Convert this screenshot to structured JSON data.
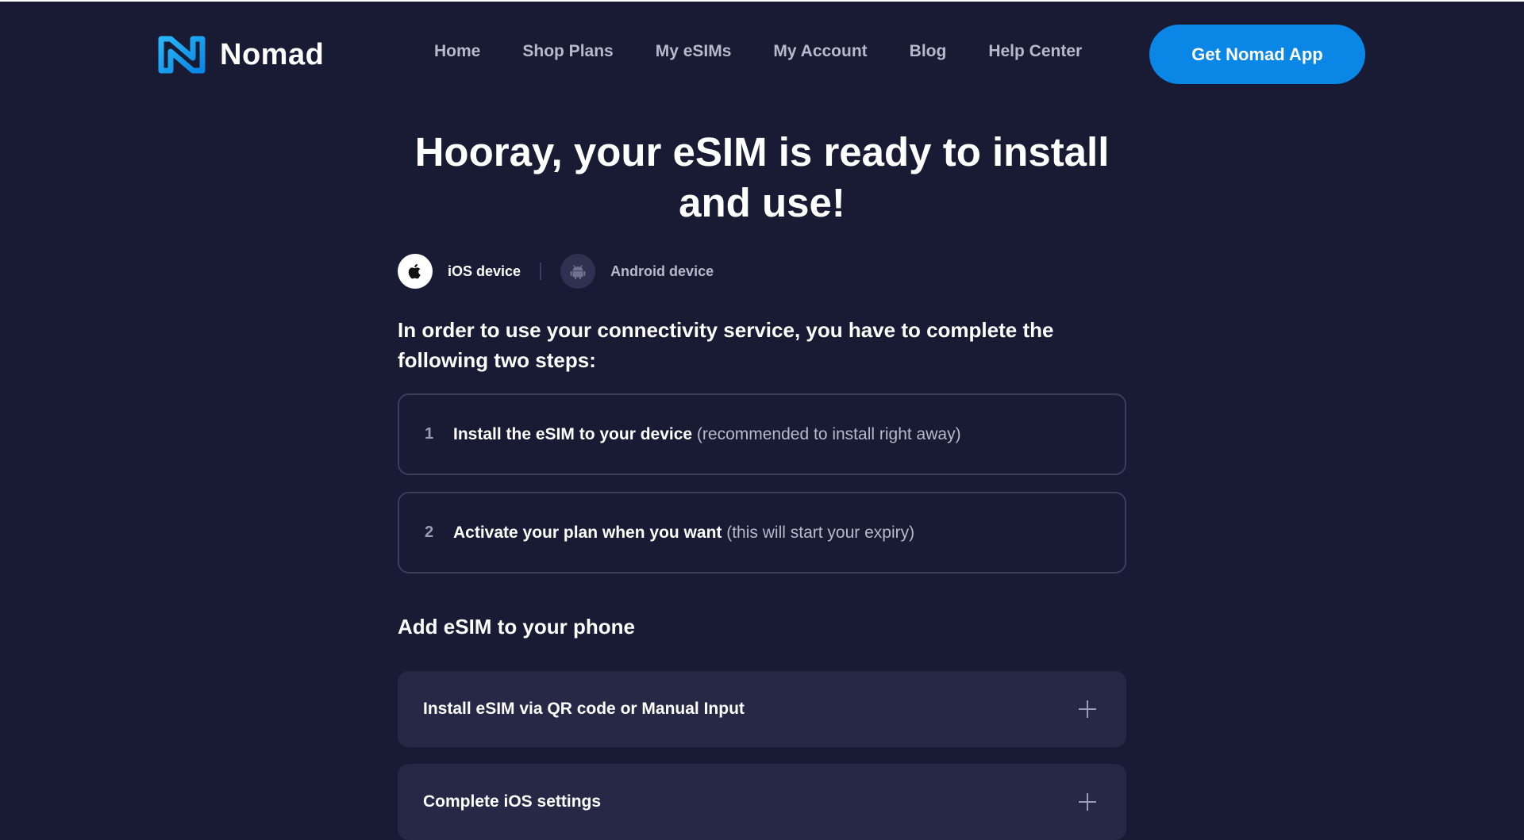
{
  "header": {
    "logo_text": "Nomad",
    "nav": [
      {
        "label": "Home"
      },
      {
        "label": "Shop Plans"
      },
      {
        "label": "My eSIMs"
      },
      {
        "label": "My Account"
      },
      {
        "label": "Blog"
      },
      {
        "label": "Help Center"
      }
    ],
    "cta_label": "Get Nomad App"
  },
  "main": {
    "title_line1": "Hooray, your eSIM is ready to install",
    "title_line2": "and use!",
    "device_tabs": [
      {
        "label": "iOS device",
        "icon": "apple-icon",
        "selected": true
      },
      {
        "label": "Android device",
        "icon": "android-icon",
        "selected": false
      }
    ],
    "intro": "In order to use your connectivity service, you have to complete the following two steps:",
    "steps": [
      {
        "number": "1",
        "strong": "Install the eSIM to your device",
        "muted": "(recommended to install right away)"
      },
      {
        "number": "2",
        "strong": "Activate your plan when you want",
        "muted": "(this will start your expiry)"
      }
    ],
    "section_title": "Add eSIM to your phone",
    "accordions": [
      {
        "label": "Install eSIM via QR code or Manual Input",
        "icon": "plus-icon"
      },
      {
        "label": "Complete iOS settings",
        "icon": "plus-icon"
      }
    ]
  },
  "colors": {
    "background": "#191a33",
    "accent": "#0a86e6",
    "card": "#262845",
    "border": "#3b3d5c",
    "muted_text": "#b7b9cc"
  }
}
